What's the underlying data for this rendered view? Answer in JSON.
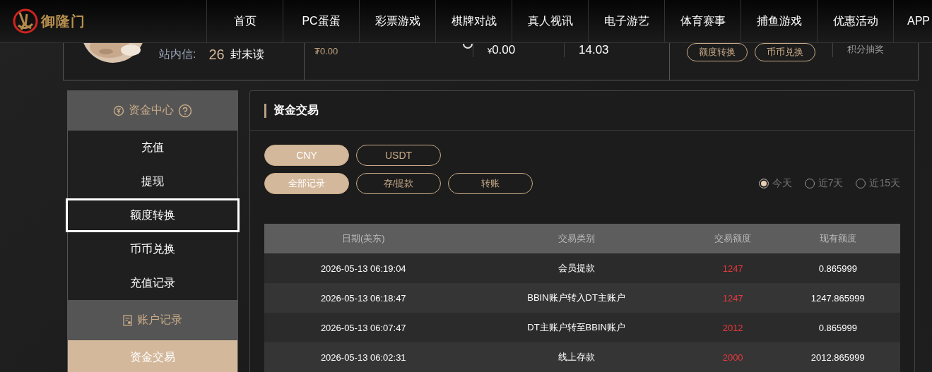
{
  "logo": {
    "name": "御隆门"
  },
  "nav": [
    {
      "label": "首页"
    },
    {
      "label": "PC蛋蛋"
    },
    {
      "label": "彩票游戏"
    },
    {
      "label": "棋牌对战"
    },
    {
      "label": "真人视讯"
    },
    {
      "label": "电子游艺"
    },
    {
      "label": "体育赛事"
    },
    {
      "label": "捕鱼游戏"
    },
    {
      "label": "优惠活动"
    },
    {
      "label": "APP"
    }
  ],
  "profile": {
    "inbox_label": "站内信:",
    "inbox_count": "26",
    "inbox_suffix": "封未读",
    "usdt_balance": "₮0.00",
    "currency_sign": "¥",
    "cny_balance": "0.00",
    "points": "14.03",
    "actions": [
      "额度转换",
      "币币兑换"
    ],
    "lottery": "积分抽奖"
  },
  "sidebar": {
    "sections": [
      {
        "title": "资金中心",
        "help": true,
        "items": [
          {
            "label": "充值",
            "selected": false,
            "focused": false
          },
          {
            "label": "提现",
            "selected": false,
            "focused": false
          },
          {
            "label": "额度转换",
            "selected": false,
            "focused": true
          },
          {
            "label": "币币兑换",
            "selected": false,
            "focused": false
          },
          {
            "label": "充值记录",
            "selected": false,
            "focused": false
          }
        ]
      },
      {
        "title": "账户记录",
        "help": false,
        "items": [
          {
            "label": "资金交易",
            "selected": true,
            "focused": false
          }
        ]
      }
    ]
  },
  "panel": {
    "title": "资金交易",
    "currencies": [
      {
        "label": "CNY",
        "selected": true
      },
      {
        "label": "USDT",
        "selected": false
      }
    ],
    "filters": [
      {
        "label": "全部记录",
        "selected": true
      },
      {
        "label": "存/提款",
        "selected": false
      },
      {
        "label": "转账",
        "selected": false
      }
    ],
    "periods": [
      {
        "label": "今天",
        "selected": true
      },
      {
        "label": "近7天",
        "selected": false
      },
      {
        "label": "近15天",
        "selected": false
      }
    ],
    "table": {
      "columns": [
        "日期(美东)",
        "交易类别",
        "交易额度",
        "现有额度"
      ],
      "rows": [
        [
          "2026-05-13 06:19:04",
          "会员提款",
          "1247",
          "0.865999"
        ],
        [
          "2026-05-13 06:18:47",
          "BBIN账户转入DT主账户",
          "1247",
          "1247.865999"
        ],
        [
          "2026-05-13 06:07:47",
          "DT主账户转至BBIN账户",
          "2012",
          "0.865999"
        ],
        [
          "2026-05-13 06:02:31",
          "线上存款",
          "2000",
          "2012.865999"
        ]
      ]
    }
  }
}
